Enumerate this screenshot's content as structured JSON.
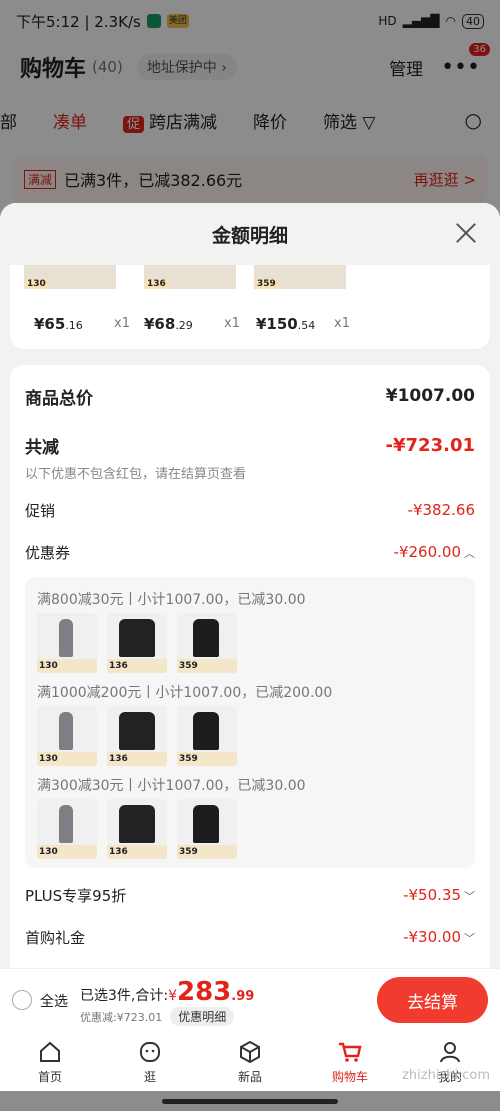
{
  "statusbar": {
    "time_net": "下午5:12 | 2.3K/s",
    "badge2": "美团",
    "battery": "40",
    "right_sig": "HD"
  },
  "cart_header": {
    "title": "购物车",
    "count": "(40)",
    "address": "地址保护中",
    "manage": "管理",
    "more_badge": "36"
  },
  "filters": {
    "item_prev": "部",
    "item_combine": "凑单",
    "promo_icon": "促",
    "item_cross": "跨店满减",
    "item_drop": "降价",
    "item_filter": "筛选"
  },
  "promo_strip": {
    "tag": "满减",
    "text": "已满3件，已减382.66元",
    "more": "再逛逛 >"
  },
  "sheet": {
    "title": "金额明细",
    "products": [
      {
        "badge": "130",
        "price": "¥65",
        "decimal": ".16",
        "qty": "x1"
      },
      {
        "badge": "136",
        "price": "¥68",
        "decimal": ".29",
        "qty": "x1"
      },
      {
        "badge": "359",
        "price": "¥150",
        "decimal": ".54",
        "qty": "x1"
      }
    ],
    "total_label": "商品总价",
    "total_value": "¥1007.00",
    "reduce_label": "共减",
    "reduce_value": "-¥723.01",
    "note": "以下优惠不包含红包，请在结算页查看",
    "promo_label": "促销",
    "promo_value": "-¥382.66",
    "coupon_label": "优惠券",
    "coupon_value": "-¥260.00",
    "coupon_groups": [
      {
        "title": "满800减30元丨小计1007.00，已减30.00",
        "prices": [
          "130",
          "136",
          "359"
        ]
      },
      {
        "title": "满1000减200元丨小计1007.00，已减200.00",
        "prices": [
          "130",
          "136",
          "359"
        ]
      },
      {
        "title": "满300减30元丨小计1007.00，已减30.00",
        "prices": [
          "130",
          "136",
          "359"
        ]
      }
    ],
    "plus_label": "PLUS专享95折",
    "plus_value": "-¥50.35",
    "first_label": "首购礼金",
    "first_value": "-¥30.00"
  },
  "bottom_bar": {
    "select_all": "全选",
    "selected_text": "已选3件,合计:",
    "currency": "¥",
    "amount_int": "283",
    "amount_dec": ".99",
    "discount_text": "优惠减:¥723.01",
    "detail_pill": "优惠明细",
    "checkout": "去结算"
  },
  "tabs": [
    {
      "label": "首页"
    },
    {
      "label": "逛"
    },
    {
      "label": "新品"
    },
    {
      "label": "购物车"
    },
    {
      "label": "我的"
    }
  ],
  "watermark": "zhizhizhi.com",
  "colors": {
    "accent": "#e2231a",
    "checkout": "#f13b2e"
  }
}
